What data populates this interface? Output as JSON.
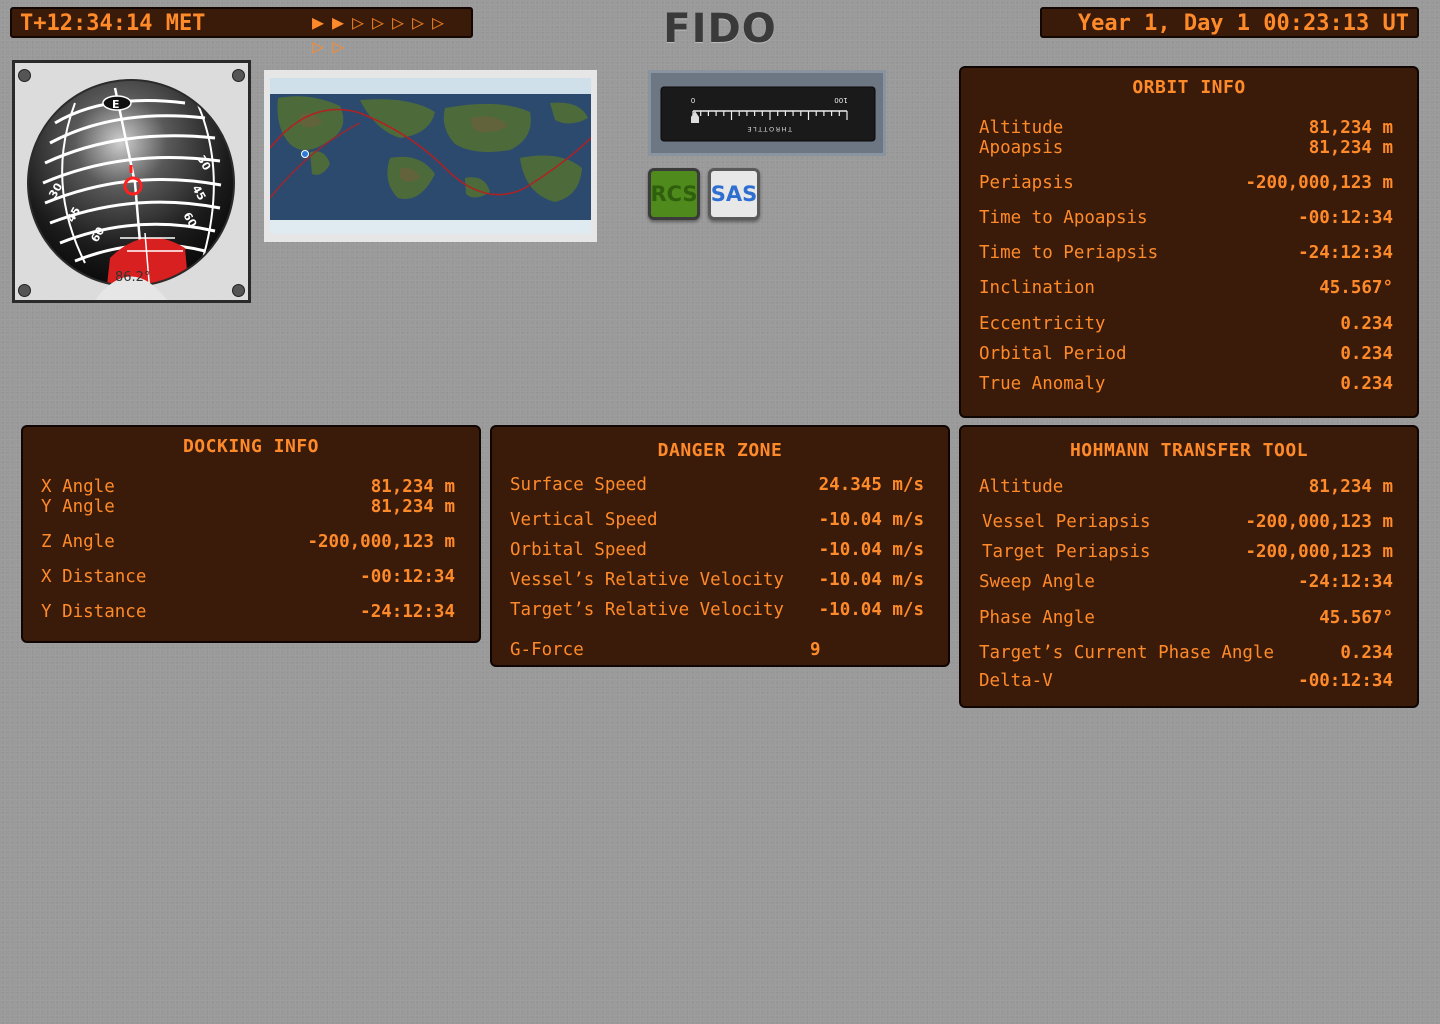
{
  "header": {
    "met": "T+12:34:14 MET",
    "warp_arrows": [
      "▶",
      "▶",
      "▷",
      "▷",
      "▷",
      "▷",
      "▷",
      "▷",
      "▷"
    ],
    "title": "FIDO",
    "ut": "Year 1, Day 1 00:23:13 UT"
  },
  "navball": {
    "heading_marker": "E",
    "labels": [
      "30",
      "30",
      "45",
      "45",
      "60",
      "60"
    ],
    "readout": "86.2°"
  },
  "throttle": {
    "min": "0",
    "max": "100",
    "label": "THROTTLE"
  },
  "toggles": {
    "rcs": "RCS",
    "sas": "SAS"
  },
  "orbit": {
    "title": "ORBIT INFO",
    "rows": [
      {
        "label": "Altitude",
        "value": "81,234 m"
      },
      {
        "label": "Apoapsis",
        "value": "81,234 m"
      },
      {
        "label": "Periapsis",
        "value": "-200,000,123 m"
      },
      {
        "label": "Time to Apoapsis",
        "value": "-00:12:34"
      },
      {
        "label": "Time to Periapsis",
        "value": "-24:12:34"
      },
      {
        "label": "Inclination",
        "value": "45.567°"
      },
      {
        "label": "Eccentricity",
        "value": "0.234"
      },
      {
        "label": "Orbital Period",
        "value": "0.234"
      },
      {
        "label": "True Anomaly",
        "value": "0.234"
      }
    ]
  },
  "docking": {
    "title": "DOCKING INFO",
    "rows": [
      {
        "label": "X Angle",
        "value": "81,234 m"
      },
      {
        "label": "Y Angle",
        "value": "81,234 m"
      },
      {
        "label": "Z Angle",
        "value": "-200,000,123 m"
      },
      {
        "label": "X Distance",
        "value": "-00:12:34"
      },
      {
        "label": "Y Distance",
        "value": "-24:12:34"
      }
    ]
  },
  "danger": {
    "title": "DANGER ZONE",
    "rows": [
      {
        "label": "Surface Speed",
        "value": "24.345 m/s"
      },
      {
        "label": "Vertical Speed",
        "value": "-10.04 m/s"
      },
      {
        "label": "Orbital Speed",
        "value": "-10.04 m/s"
      },
      {
        "label": "Vessel’s Relative Velocity",
        "value": "-10.04 m/s"
      },
      {
        "label": "Target’s Relative Velocity",
        "value": "-10.04 m/s"
      },
      {
        "label": "G-Force",
        "value": "9"
      }
    ]
  },
  "hohmann": {
    "title": "HOHMANN TRANSFER TOOL",
    "rows": [
      {
        "label": "Altitude",
        "value": "81,234 m"
      },
      {
        "label": "Vessel Periapsis",
        "value": "-200,000,123 m"
      },
      {
        "label": "Target Periapsis",
        "value": "-200,000,123 m"
      },
      {
        "label": "Sweep Angle",
        "value": "-24:12:34"
      },
      {
        "label": "Phase Angle",
        "value": "45.567°"
      },
      {
        "label": "Target’s Current Phase Angle",
        "value": "0.234"
      },
      {
        "label": "Delta-V",
        "value": "-00:12:34"
      }
    ]
  },
  "colors": {
    "panel_bg": "#3a1a08",
    "panel_text": "#ff8a2a",
    "rcs_green": "#4f8a1c",
    "sas_blue": "#2e6fd0",
    "orbit_track": "#b32020"
  }
}
